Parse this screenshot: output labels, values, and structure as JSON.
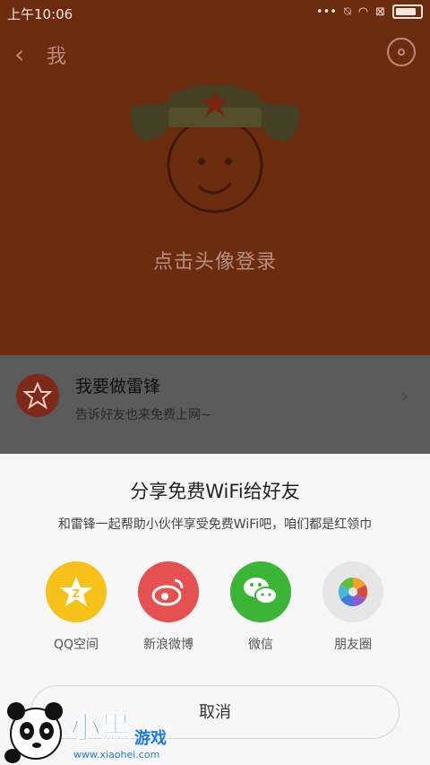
{
  "statusbar": {
    "time": "上午10:06"
  },
  "header": {
    "title": "我"
  },
  "profile": {
    "login_text": "点击头像登录"
  },
  "promo": {
    "title": "我要做雷锋",
    "subtitle": "告诉好友也来免费上网~"
  },
  "share_sheet": {
    "title": "分享免费WiFi给好友",
    "subtitle": "和雷锋一起帮助小伙伴享受免费WiFi吧，咱们都是红领巾",
    "items": [
      {
        "label": "QQ空间",
        "icon": "qzone-icon",
        "color": "#f6c21a"
      },
      {
        "label": "新浪微博",
        "icon": "weibo-icon",
        "color": "#e55150"
      },
      {
        "label": "微信",
        "icon": "wechat-icon",
        "color": "#3bb535"
      },
      {
        "label": "朋友圈",
        "icon": "moments-icon",
        "color": "#e6e6e6"
      }
    ],
    "cancel_label": "取消"
  },
  "watermark": {
    "brand": "小黑游戏",
    "url": "www.xiaohei.com"
  },
  "colors": {
    "hero_bg": "#6b2c0f",
    "sheet_bg": "#f6f6f6",
    "promo_icon_bg": "#7e2a1b"
  }
}
